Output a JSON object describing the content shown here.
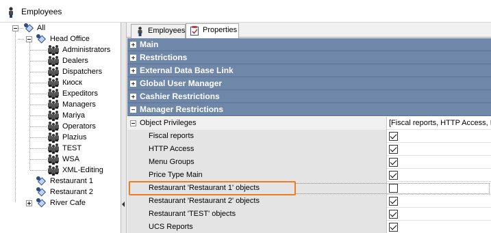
{
  "window": {
    "title": "Employees"
  },
  "tree": {
    "root": "All",
    "head_office": "Head Office",
    "groups": [
      "Administrators",
      "Dealers",
      "Dispatchers",
      "Киоск",
      "Expeditors",
      "Managers",
      "Mariya",
      "Operators",
      "Plazius",
      "TEST",
      "WSA",
      "XML-Editing"
    ],
    "restaurants": [
      "Restaurant 1",
      "Restaurant 2",
      "River Cafe"
    ]
  },
  "tabs": [
    {
      "label": "Employees",
      "active": false
    },
    {
      "label": "Properties",
      "active": true
    }
  ],
  "sections": [
    {
      "label": "Main",
      "expanded": false
    },
    {
      "label": "Restrictions",
      "expanded": false
    },
    {
      "label": "External Data Base Link",
      "expanded": false
    },
    {
      "label": "Global User Manager",
      "expanded": false
    },
    {
      "label": "Cashier Restrictions",
      "expanded": false
    },
    {
      "label": "Manager Restrictions",
      "expanded": true
    }
  ],
  "object_privileges": {
    "label": "Object Privileges",
    "value": "[Fiscal reports, HTTP Access, Menu Groups, Price Type Main, Restau",
    "items": [
      {
        "label": "Fiscal reports",
        "checked": true
      },
      {
        "label": "HTTP Access",
        "checked": true
      },
      {
        "label": "Menu Groups",
        "checked": true
      },
      {
        "label": "Price Type Main",
        "checked": true
      },
      {
        "label": "Restaurant 'Restaurant 1' objects",
        "checked": false
      },
      {
        "label": "Restaurant 'Restaurant 2' objects",
        "checked": true
      },
      {
        "label": "Restaurant 'TEST' objects",
        "checked": true
      },
      {
        "label": "UCS Reports",
        "checked": true
      }
    ]
  },
  "colors": {
    "section_header": "#6f87a8",
    "highlight": "#f07b21"
  }
}
